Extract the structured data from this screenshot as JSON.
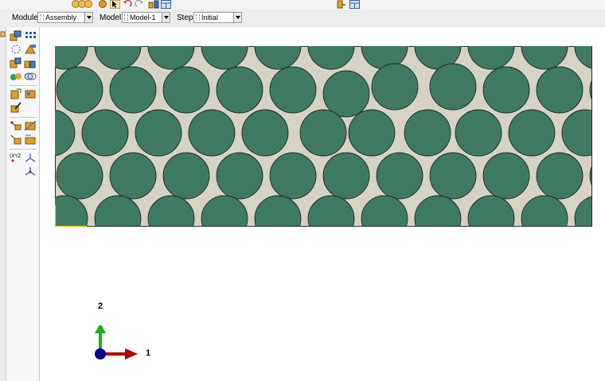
{
  "context_bar": {
    "module_label": "Module:",
    "module_value": "Assembly",
    "model_label": "Model:",
    "model_value": "Model-1",
    "step_label": "Step:",
    "step_value": "Initial"
  },
  "toolbar_icons": [
    "render-style-icon",
    "shaded-sphere-icon",
    "select-arrow-icon",
    "undo-icon",
    "redo-icon",
    "query-icon",
    "view-manager-icon"
  ],
  "toolbox_icons": [
    "instance-part-icon",
    "linear-pattern-icon",
    "translate-instance-icon",
    "rotate-instance-icon",
    "constraint-parallel-face-icon",
    "constraint-face-to-face-icon",
    "merge-cut-icon",
    "boolean-icon",
    "create-set-icon",
    "create-surface-icon",
    "edit-feature-icon",
    "datum-point-icon",
    "datum-axis-icon",
    "datum-csys-icon",
    "coordinate-triad-icon"
  ],
  "colors": {
    "matrix": "#d7d3c4",
    "fiber": "#3e7a62",
    "fiber_outline": "#1f2a25",
    "axis_x": "#b00000",
    "axis_y": "#17b317",
    "origin": "#00008b"
  },
  "triad": {
    "x_label": "1",
    "y_label": "2"
  }
}
